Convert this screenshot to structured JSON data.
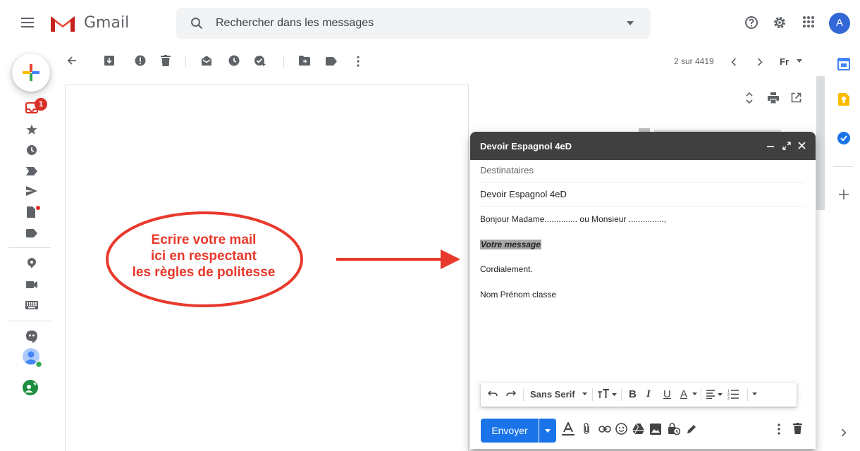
{
  "header": {
    "brand": "Gmail",
    "search_placeholder": "Rechercher dans les messages",
    "avatar_letter": "A"
  },
  "icons": {
    "menu": "hamburger-icon",
    "search": "search-icon",
    "help": "help-icon",
    "settings": "gear-icon",
    "apps": "apps-icon"
  },
  "sidebar": {
    "inbox_badge": "1"
  },
  "toolbar": {
    "pager": "2 sur 4419",
    "lang": "Fr"
  },
  "annotation": {
    "bubble_lines": [
      "Ecrire votre mail",
      "ici en respectant",
      "les règles de politesse"
    ]
  },
  "compose": {
    "window_title": "Devoir Espagnol 4eD",
    "to_placeholder": "Destinataires",
    "subject": "Devoir Espagnol 4eD",
    "body": {
      "greeting": "Bonjour Madame.............. ou Monsieur ...............,",
      "message": "Votre message",
      "closing": "Cordialement.",
      "signature": "Nom Prénom classe"
    },
    "format": {
      "font": "Sans Serif",
      "bold": "B",
      "italic": "I",
      "underline": "U",
      "color": "A"
    },
    "send_label": "Envoyer"
  },
  "colors": {
    "accent": "#1a73e8",
    "annotation": "#e8392c",
    "compose_bar": "#404040"
  }
}
